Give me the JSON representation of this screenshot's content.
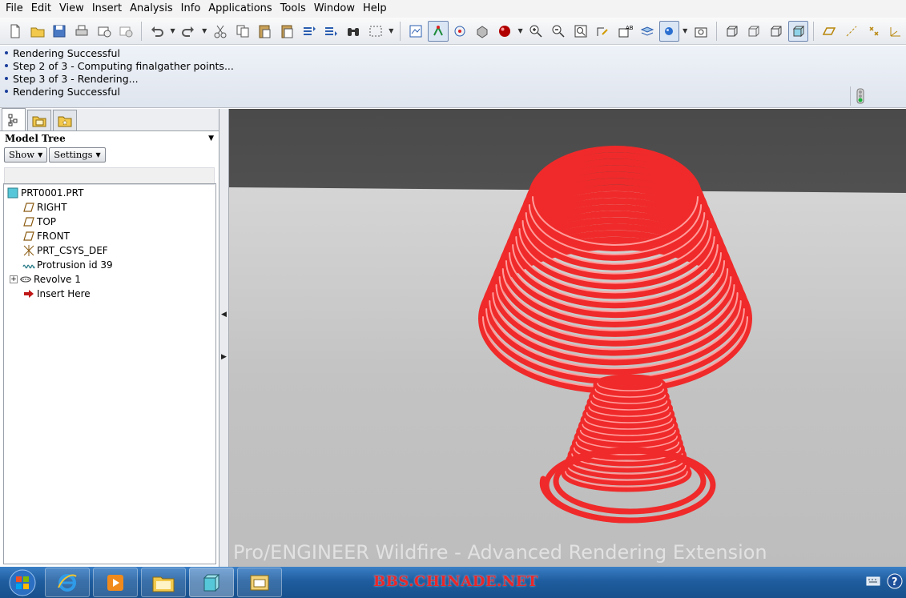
{
  "menu": {
    "items": [
      {
        "label": "File"
      },
      {
        "label": "Edit"
      },
      {
        "label": "View"
      },
      {
        "label": "Insert"
      },
      {
        "label": "Analysis"
      },
      {
        "label": "Info"
      },
      {
        "label": "Applications"
      },
      {
        "label": "Tools"
      },
      {
        "label": "Window"
      },
      {
        "label": "Help"
      }
    ]
  },
  "messages": [
    {
      "text": "Rendering Successful"
    },
    {
      "text": "Step 2 of 3 - Computing finalgather points..."
    },
    {
      "text": "Step 3 of 3 - Rendering..."
    },
    {
      "text": "Rendering Successful"
    }
  ],
  "model_tree": {
    "title": "Model Tree",
    "show_label": "Show",
    "settings_label": "Settings",
    "nodes": [
      {
        "label": "PRT0001.PRT",
        "icon": "part-icon"
      },
      {
        "label": "RIGHT",
        "icon": "datum-plane-icon"
      },
      {
        "label": "TOP",
        "icon": "datum-plane-icon"
      },
      {
        "label": "FRONT",
        "icon": "datum-plane-icon"
      },
      {
        "label": "PRT_CSYS_DEF",
        "icon": "coordinate-system-icon"
      },
      {
        "label": "Protrusion id 39",
        "icon": "protrusion-icon"
      },
      {
        "label": "Revolve 1",
        "icon": "revolve-icon"
      },
      {
        "label": "Insert Here",
        "icon": "insert-arrow-icon"
      }
    ]
  },
  "viewport": {
    "watermark": "Pro/ENGINEER Wildfire - Advanced Rendering Extension",
    "model_color": "#f02a2a"
  },
  "taskbar": {
    "forum_text": "BBS.CHINADE.NET"
  },
  "colors": {
    "accent_blue": "#1c3f9b",
    "taskbar": "#1f5d9f",
    "forum_red": "#e8282a"
  }
}
